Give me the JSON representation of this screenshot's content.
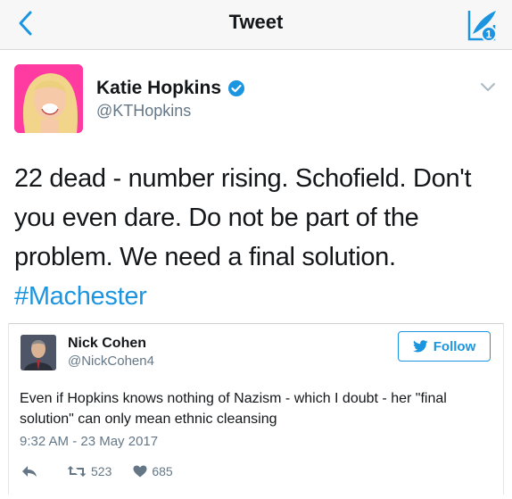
{
  "header": {
    "title": "Tweet",
    "back_icon": "chevron-left-icon",
    "compose_icon": "compose-tweet-icon",
    "accent": "#1b95e0"
  },
  "tweet": {
    "author_name": "Katie Hopkins",
    "author_handle": "@KTHopkins",
    "verified": true,
    "text": "22 dead - number rising. Schofield. Don't you even dare. Do not be part of the problem. We need a final solution.",
    "hashtag": "#Machester"
  },
  "quote": {
    "author_name": "Nick Cohen",
    "author_handle": "@NickCohen4",
    "follow_label": "Follow",
    "text": "Even if Hopkins knows nothing of Nazism - which I doubt - her \"final solution\" can only mean ethnic cleansing",
    "timestamp": "9:32 AM - 23 May 2017",
    "retweets": "523",
    "likes": "685"
  }
}
